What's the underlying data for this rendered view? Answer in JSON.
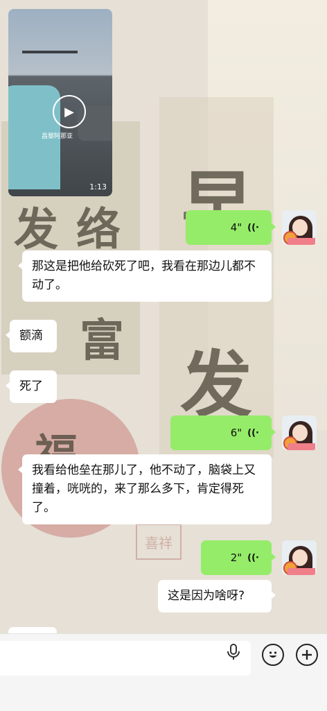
{
  "background": {
    "glyphs": [
      "早",
      "发",
      "发",
      "络",
      "富",
      "福"
    ],
    "seal_text": "喜祥"
  },
  "video": {
    "caption": "昌黎阿那亚",
    "duration": "1:13"
  },
  "messages": [
    {
      "id": "voice1",
      "type": "voice",
      "side": "right",
      "duration": "4\""
    },
    {
      "id": "text1",
      "type": "text",
      "side": "left",
      "text": "那这是把他给砍死了吧，我看在那边儿都不动了。"
    },
    {
      "id": "text2",
      "type": "text",
      "side": "left",
      "text": "额滴"
    },
    {
      "id": "text3",
      "type": "text",
      "side": "left",
      "text": "死了"
    },
    {
      "id": "voice2",
      "type": "voice",
      "side": "right",
      "duration": "6\""
    },
    {
      "id": "text4",
      "type": "text",
      "side": "left",
      "text": "我看给他垒在那儿了，他不动了，脑袋上又撞着，咣咣的，来了那么多下，肯定得死了。"
    },
    {
      "id": "voice3",
      "type": "voice",
      "side": "right",
      "duration": "2\""
    },
    {
      "id": "text5",
      "type": "text",
      "side": "right",
      "text": "这是因为啥呀?"
    }
  ],
  "input_bar": {
    "text": "",
    "icons": [
      "microphone-icon",
      "emoji-icon",
      "plus-icon"
    ]
  },
  "colors": {
    "voice_bubble": "#95ec69",
    "text_bubble": "#ffffff",
    "input_bar": "#f5f5f5"
  }
}
